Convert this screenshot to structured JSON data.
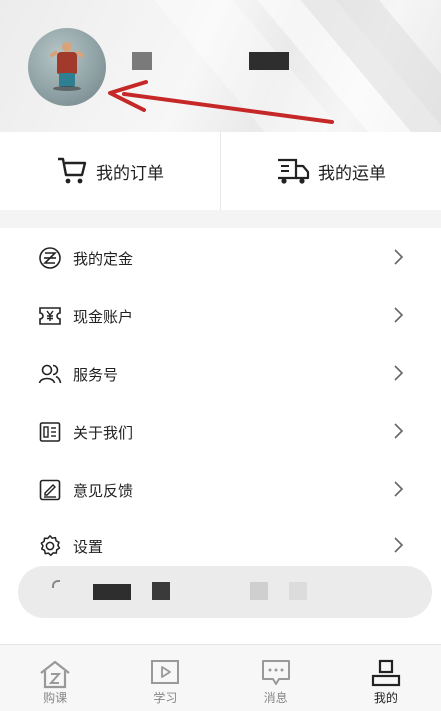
{
  "orders": {
    "my_orders": "我的订单",
    "my_shipments": "我的运单"
  },
  "menu": [
    {
      "label": "我的定金",
      "icon": "deposit-icon"
    },
    {
      "label": "现金账户",
      "icon": "cash-account-icon"
    },
    {
      "label": "服务号",
      "icon": "service-account-icon"
    },
    {
      "label": "关于我们",
      "icon": "about-us-icon"
    },
    {
      "label": "意见反馈",
      "icon": "feedback-icon"
    },
    {
      "label": "设置",
      "icon": "settings-icon"
    }
  ],
  "tabbar": [
    {
      "label": "购课",
      "icon": "course-purchase-icon"
    },
    {
      "label": "学习",
      "icon": "study-play-icon"
    },
    {
      "label": "消息",
      "icon": "message-icon"
    },
    {
      "label": "我的",
      "icon": "profile-icon",
      "active": true
    }
  ],
  "colors": {
    "annotation_arrow": "#c62828",
    "text_primary": "#222222",
    "text_muted": "#888888"
  }
}
